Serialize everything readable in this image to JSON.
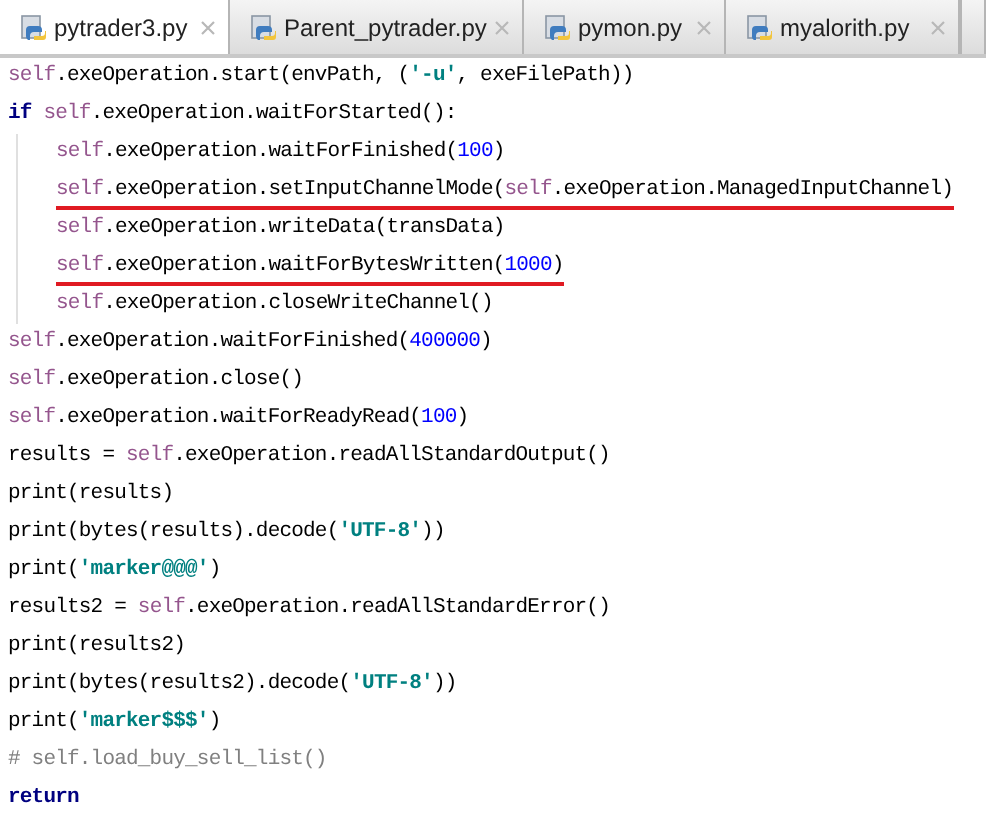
{
  "tabs": [
    {
      "label": "pytrader3.py",
      "selected": true
    },
    {
      "label": "Parent_pytrader.py",
      "selected": false
    },
    {
      "label": "pymon.py",
      "selected": false
    },
    {
      "label": "myalorith.py",
      "selected": false
    }
  ],
  "code": [
    {
      "tokens": [
        {
          "kind": "self",
          "text": "self"
        },
        {
          "kind": "plain",
          "text": ".exeOperation.start(envPath, ("
        },
        {
          "kind": "string",
          "text": "'-u'"
        },
        {
          "kind": "plain",
          "text": ", exeFilePath))"
        }
      ]
    },
    {
      "tokens": [
        {
          "kind": "keyword",
          "text": "if"
        },
        {
          "kind": "self",
          "text": " self"
        },
        {
          "kind": "plain",
          "text": ".exeOperation.waitForStarted():"
        }
      ],
      "children": [
        {
          "tokens": [
            {
              "kind": "self",
              "text": "self"
            },
            {
              "kind": "plain",
              "text": ".exeOperation.waitForFinished("
            },
            {
              "kind": "number",
              "text": "100"
            },
            {
              "kind": "plain",
              "text": ")"
            }
          ]
        },
        {
          "underlined": true,
          "tokens": [
            {
              "kind": "self",
              "text": "self"
            },
            {
              "kind": "plain",
              "text": ".exeOperation.setInputChannelMode("
            },
            {
              "kind": "self",
              "text": "self"
            },
            {
              "kind": "plain",
              "text": ".exeOperation.ManagedInputChannel)"
            }
          ]
        },
        {
          "tokens": [
            {
              "kind": "self",
              "text": "self"
            },
            {
              "kind": "plain",
              "text": ".exeOperation.writeData(transData)"
            }
          ]
        },
        {
          "underlined": true,
          "tokens": [
            {
              "kind": "self",
              "text": "self"
            },
            {
              "kind": "plain",
              "text": ".exeOperation.waitForBytesWritten("
            },
            {
              "kind": "number",
              "text": "1000"
            },
            {
              "kind": "plain",
              "text": ")"
            }
          ]
        },
        {
          "tokens": [
            {
              "kind": "self",
              "text": "self"
            },
            {
              "kind": "plain",
              "text": ".exeOperation.closeWriteChannel()"
            }
          ]
        }
      ]
    },
    {
      "tokens": [
        {
          "kind": "self",
          "text": "self"
        },
        {
          "kind": "plain",
          "text": ".exeOperation.waitForFinished("
        },
        {
          "kind": "number",
          "text": "400000"
        },
        {
          "kind": "plain",
          "text": ")"
        }
      ]
    },
    {
      "tokens": [
        {
          "kind": "self",
          "text": "self"
        },
        {
          "kind": "plain",
          "text": ".exeOperation.close()"
        }
      ]
    },
    {
      "tokens": [
        {
          "kind": "self",
          "text": "self"
        },
        {
          "kind": "plain",
          "text": ".exeOperation.waitForReadyRead("
        },
        {
          "kind": "number",
          "text": "100"
        },
        {
          "kind": "plain",
          "text": ")"
        }
      ]
    },
    {
      "tokens": [
        {
          "kind": "plain",
          "text": "results = "
        },
        {
          "kind": "self",
          "text": "self"
        },
        {
          "kind": "plain",
          "text": ".exeOperation.readAllStandardOutput()"
        }
      ]
    },
    {
      "tokens": [
        {
          "kind": "plain",
          "text": "print(results)"
        }
      ]
    },
    {
      "tokens": [
        {
          "kind": "plain",
          "text": "print(bytes(results).decode("
        },
        {
          "kind": "string",
          "text": "'UTF-8'"
        },
        {
          "kind": "plain",
          "text": "))"
        }
      ]
    },
    {
      "tokens": [
        {
          "kind": "plain",
          "text": "print("
        },
        {
          "kind": "string",
          "text": "'marker@@@'"
        },
        {
          "kind": "plain",
          "text": ")"
        }
      ]
    },
    {
      "tokens": [
        {
          "kind": "plain",
          "text": "results2 = "
        },
        {
          "kind": "self",
          "text": "self"
        },
        {
          "kind": "plain",
          "text": ".exeOperation.readAllStandardError()"
        }
      ]
    },
    {
      "tokens": [
        {
          "kind": "plain",
          "text": "print(results2)"
        }
      ]
    },
    {
      "tokens": [
        {
          "kind": "plain",
          "text": "print(bytes(results2).decode("
        },
        {
          "kind": "string",
          "text": "'UTF-8'"
        },
        {
          "kind": "plain",
          "text": "))"
        }
      ]
    },
    {
      "tokens": [
        {
          "kind": "plain",
          "text": "print("
        },
        {
          "kind": "string",
          "text": "'marker$$$'"
        },
        {
          "kind": "plain",
          "text": ")"
        }
      ]
    },
    {
      "tokens": [
        {
          "kind": "comment",
          "text": "# self.load_buy_sell_list()"
        }
      ]
    },
    {
      "tokens": [
        {
          "kind": "keyword",
          "text": "return"
        }
      ]
    }
  ]
}
